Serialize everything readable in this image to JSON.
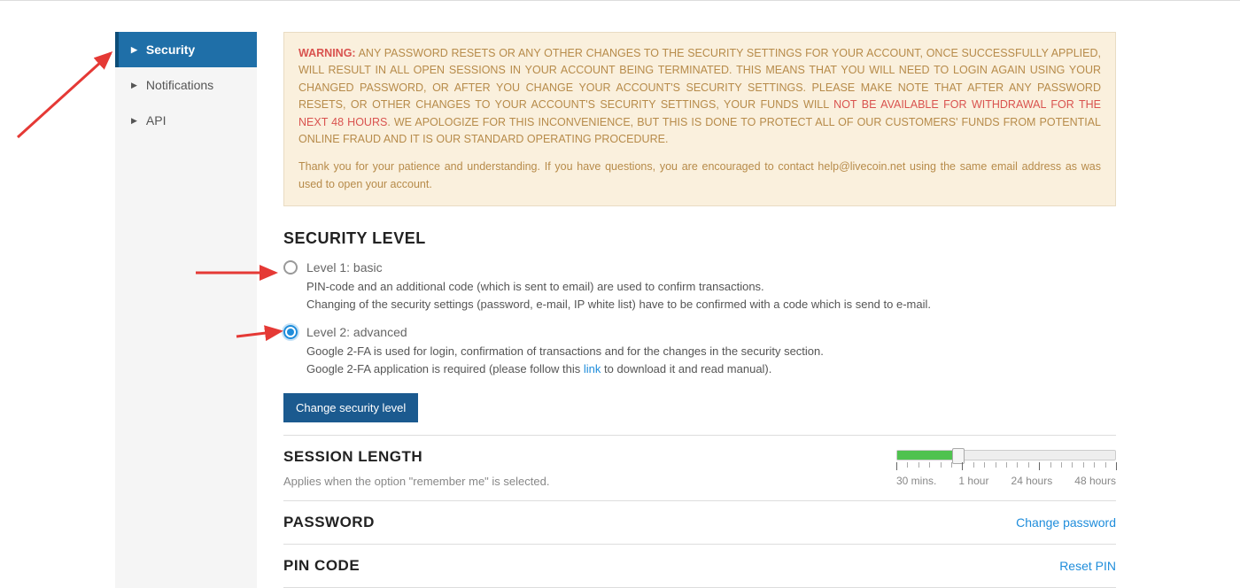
{
  "sidebar": {
    "items": [
      {
        "label": "Security",
        "active": true
      },
      {
        "label": "Notifications",
        "active": false
      },
      {
        "label": "API",
        "active": false
      }
    ]
  },
  "warning": {
    "prefix": "WARNING:",
    "text1": " ANY PASSWORD RESETS OR ANY OTHER CHANGES TO THE SECURITY SETTINGS FOR YOUR ACCOUNT, ONCE SUCCESSFULLY APPLIED, WILL RESULT IN ALL OPEN SESSIONS IN YOUR ACCOUNT BEING TERMINATED. THIS MEANS THAT YOU WILL NEED TO LOGIN AGAIN USING YOUR CHANGED PASSWORD, OR AFTER YOU CHANGE YOUR ACCOUNT'S SECURITY SETTINGS. PLEASE MAKE NOTE THAT AFTER ANY PASSWORD RESETS, OR OTHER CHANGES TO YOUR ACCOUNT'S SECURITY SETTINGS, YOUR FUNDS WILL ",
    "red": "NOT BE AVAILABLE FOR WITHDRAWAL FOR THE NEXT 48 HOURS",
    "text2": ". WE APOLOGIZE FOR THIS INCONVENIENCE, BUT THIS IS DONE TO PROTECT ALL OF OUR CUSTOMERS' FUNDS FROM POTENTIAL ONLINE FRAUD AND IT IS OUR STANDARD OPERATING PROCEDURE.",
    "thanks": "Thank you for your patience and understanding. If you have questions, you are encouraged to contact help@livecoin.net using the same email address as was used to open your account."
  },
  "securityLevel": {
    "title": "SECURITY LEVEL",
    "level1": {
      "label": "Level 1: basic",
      "desc1": "PIN-code and an additional code (which is sent to email) are used to confirm transactions.",
      "desc2": "Changing of the security settings (password, e-mail, IP white list) have to be confirmed with a code which is send to e-mail."
    },
    "level2": {
      "label": "Level 2: advanced",
      "desc1": "Google 2-FA is used for login, confirmation of transactions and for the changes in the security section.",
      "desc2a": "Google 2-FA application is required (please follow this ",
      "link": "link",
      "desc2b": " to download it and read manual)."
    },
    "button": "Change security level"
  },
  "sessionLength": {
    "title": "SESSION LENGTH",
    "sub": "Applies when the option \"remember me\" is selected.",
    "labels": [
      "30 mins.",
      "1 hour",
      "24 hours",
      "48 hours"
    ]
  },
  "password": {
    "title": "PASSWORD",
    "link": "Change password"
  },
  "pincode": {
    "title": "PIN CODE",
    "link": "Reset PIN"
  }
}
